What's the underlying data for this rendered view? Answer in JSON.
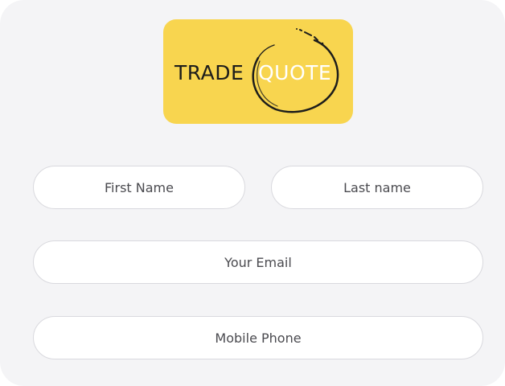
{
  "logo": {
    "word1": "TRADE",
    "word2": "QUOTE",
    "background_color": "#f8d54f"
  },
  "form": {
    "first_name": {
      "placeholder": "First Name"
    },
    "last_name": {
      "placeholder": "Last name"
    },
    "email": {
      "placeholder": "Your Email"
    },
    "phone": {
      "placeholder": "Mobile Phone"
    }
  }
}
